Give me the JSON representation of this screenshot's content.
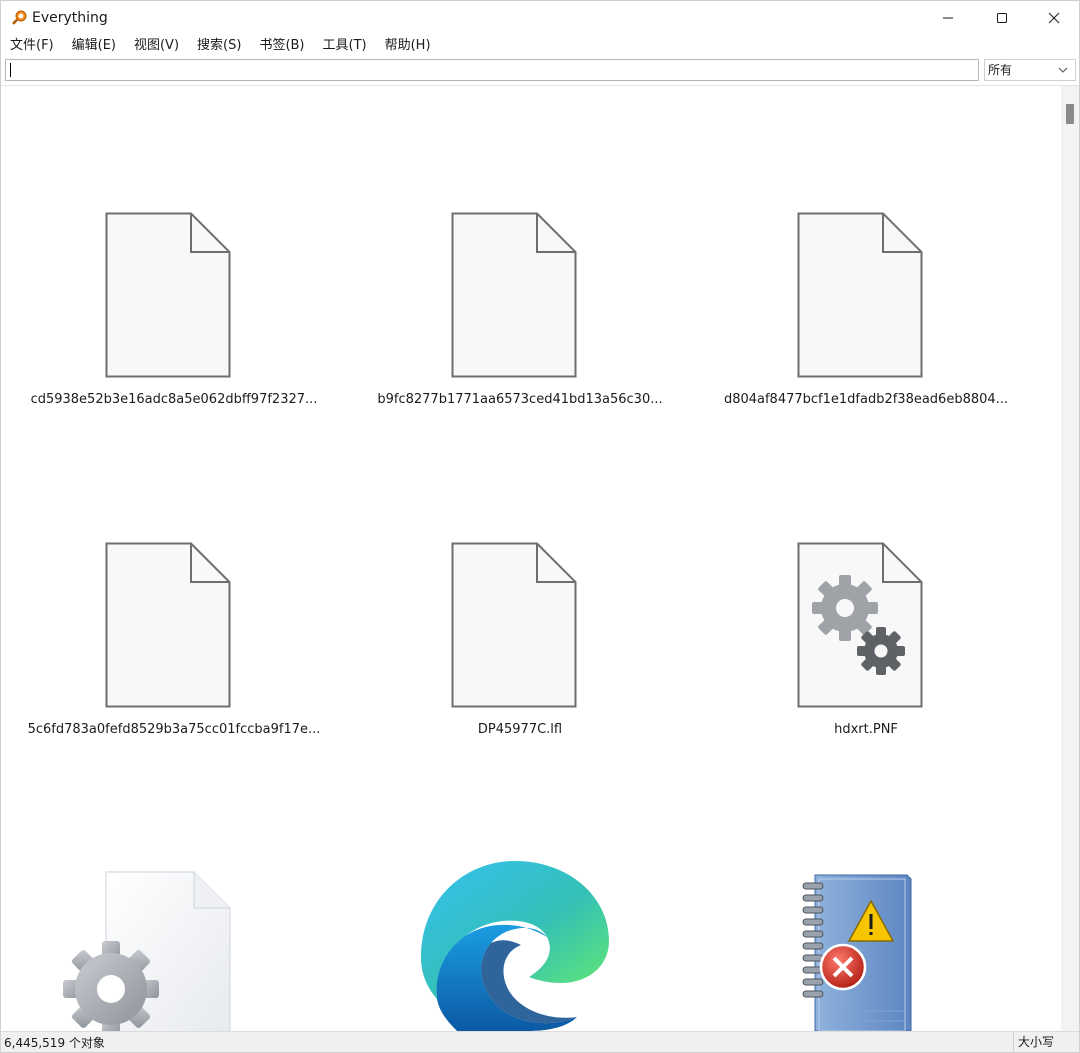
{
  "window": {
    "title": "Everything"
  },
  "menu": {
    "items": [
      "文件(F)",
      "编辑(E)",
      "视图(V)",
      "搜索(S)",
      "书签(B)",
      "工具(T)",
      "帮助(H)"
    ]
  },
  "search": {
    "value": "",
    "filter": "所有"
  },
  "files": [
    {
      "name": "cd5938e52b3e16adc8a5e062dbff97f2327...",
      "icon": "blank-file-icon"
    },
    {
      "name": "b9fc8277b1771aa6573ced41bd13a56c30...",
      "icon": "blank-file-icon"
    },
    {
      "name": "d804af8477bcf1e1dfadb2f38ead6eb8804...",
      "icon": "blank-file-icon"
    },
    {
      "name": "5c6fd783a0fefd8529b3a75cc01fccba9f17e...",
      "icon": "blank-file-icon"
    },
    {
      "name": "DP45977C.lfl",
      "icon": "blank-file-icon"
    },
    {
      "name": "hdxrt.PNF",
      "icon": "settings-file-icon"
    },
    {
      "name": "",
      "icon": "system-file-gear-icon"
    },
    {
      "name": "",
      "icon": "edge-browser-icon"
    },
    {
      "name": "",
      "icon": "error-log-notebook-icon"
    }
  ],
  "status": {
    "count": "6,445,519 个对象",
    "case": "大小写"
  },
  "colors": {
    "file_outline": "#6e6e6e",
    "file_fill": "#f8f8f8",
    "gear_light": "#9fa3a8",
    "gear_dark": "#5e6266",
    "edge_blue": "#0c59a4",
    "edge_teal": "#35c1f1",
    "edge_green": "#51c747",
    "error_red": "#c42b1c",
    "warning_yellow": "#f7c600"
  }
}
